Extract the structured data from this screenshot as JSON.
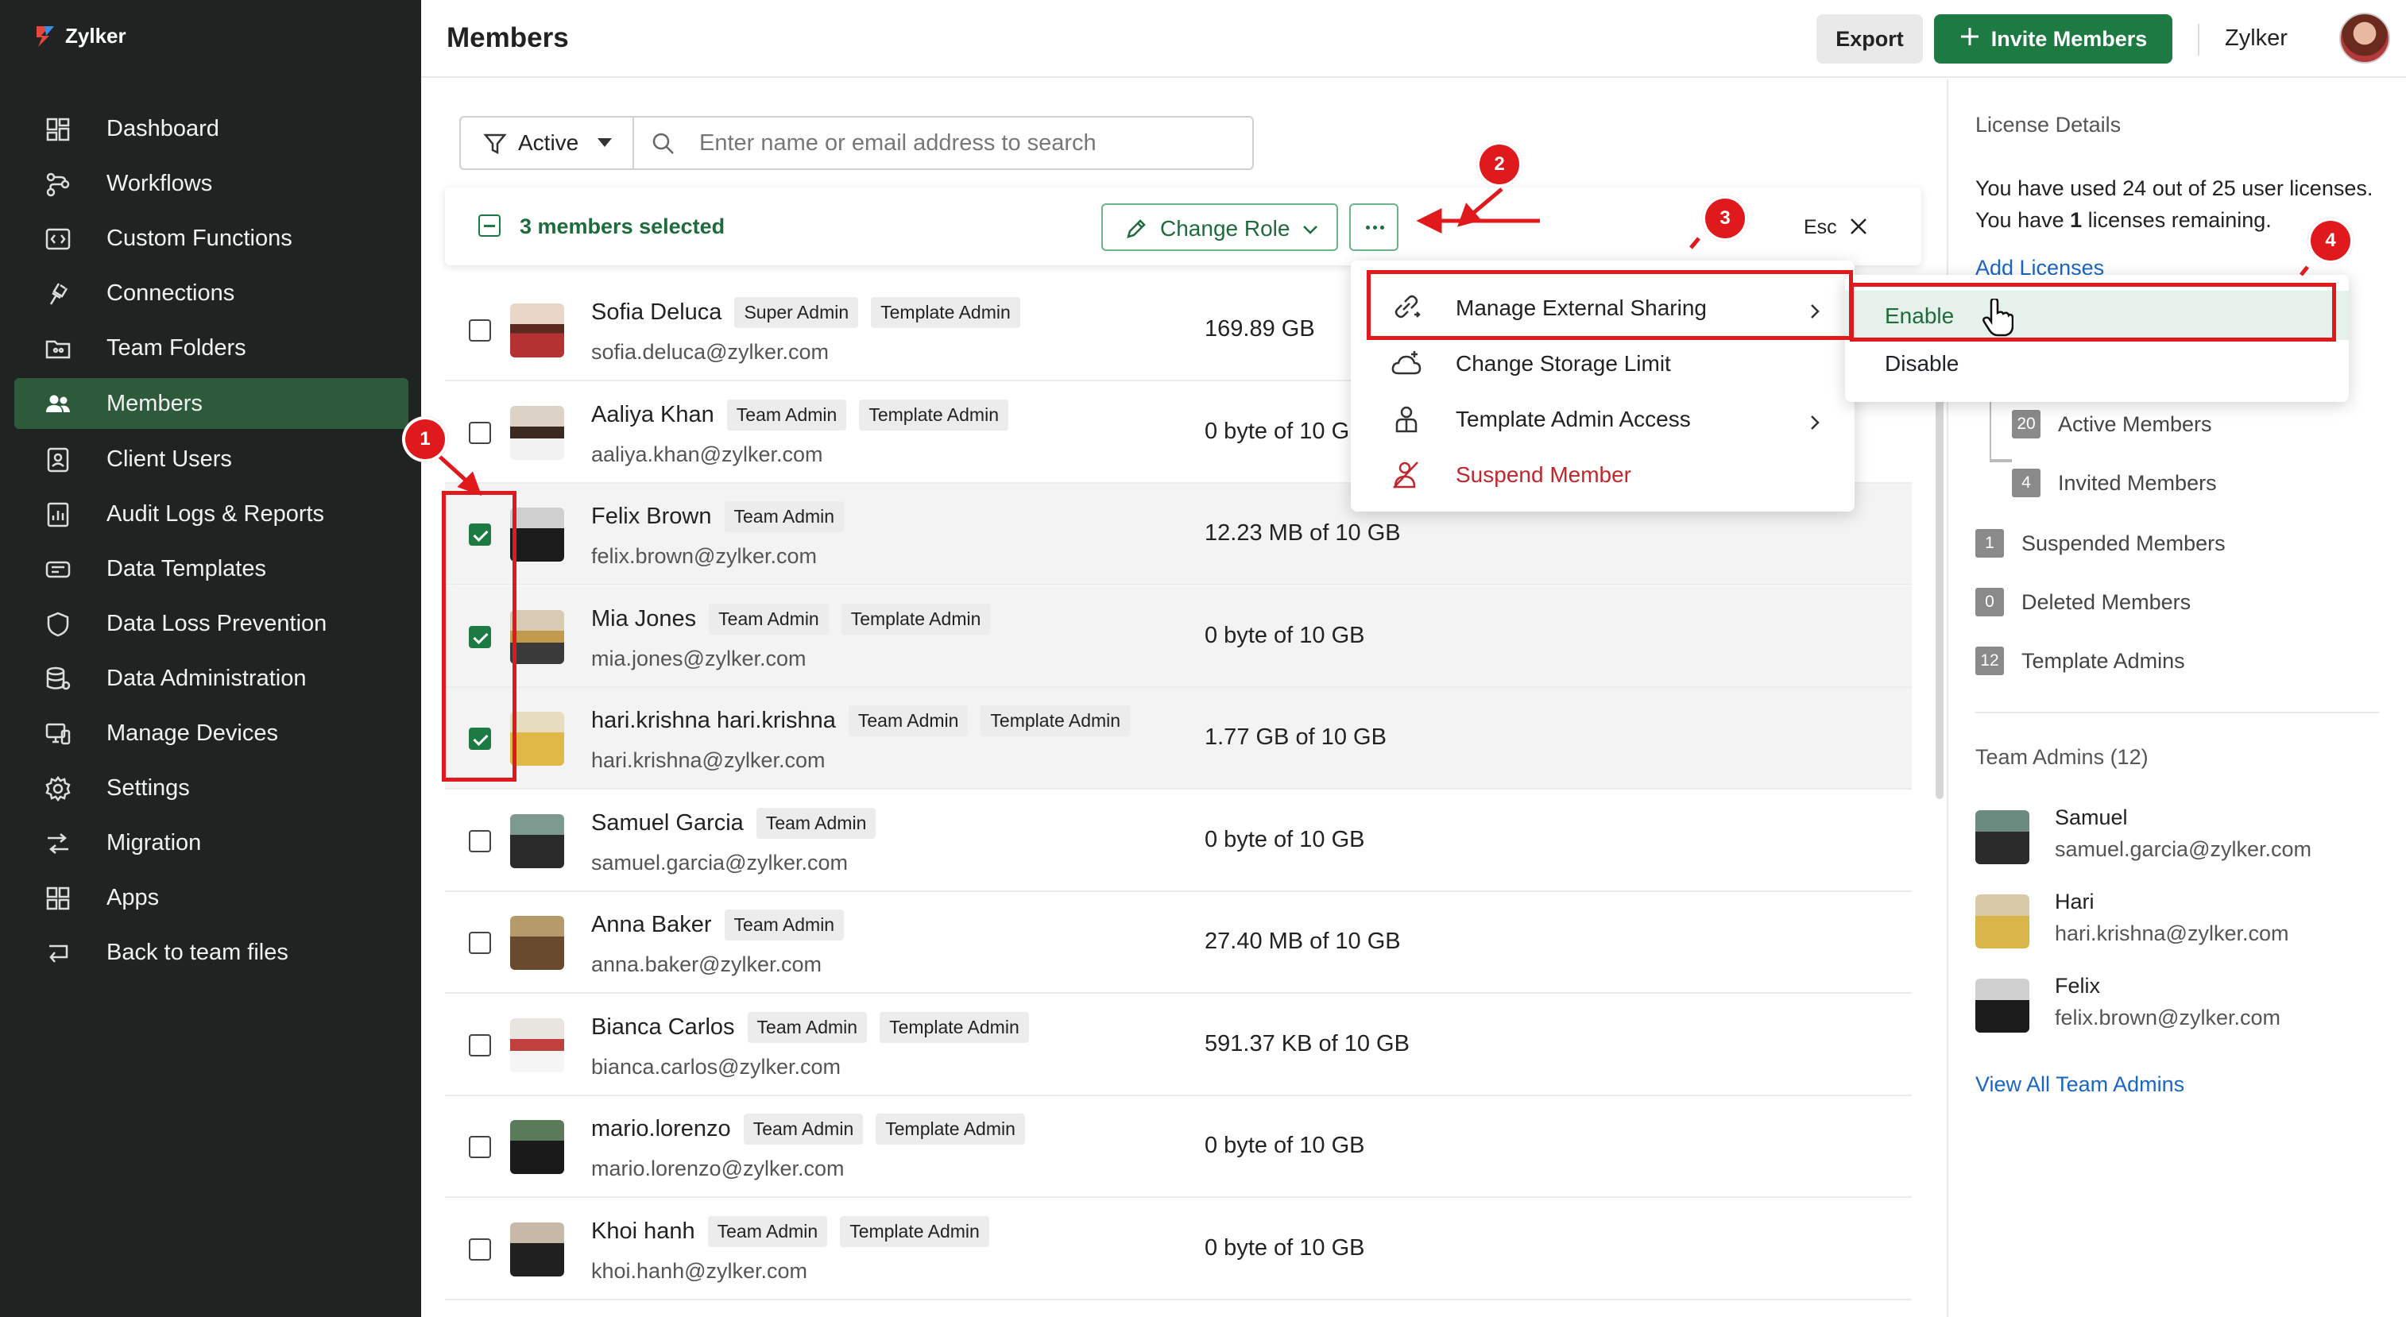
{
  "app": {
    "brand": "Zylker",
    "page_title": "Members"
  },
  "sidebar": {
    "items": [
      {
        "label": "Dashboard",
        "icon": "dashboard-icon"
      },
      {
        "label": "Workflows",
        "icon": "workflow-icon"
      },
      {
        "label": "Custom Functions",
        "icon": "code-icon"
      },
      {
        "label": "Connections",
        "icon": "plug-icon"
      },
      {
        "label": "Team Folders",
        "icon": "folder-icon"
      },
      {
        "label": "Members",
        "icon": "users-icon",
        "active": true
      },
      {
        "label": "Client Users",
        "icon": "contact-icon"
      },
      {
        "label": "Audit Logs & Reports",
        "icon": "report-icon"
      },
      {
        "label": "Data Templates",
        "icon": "template-icon"
      },
      {
        "label": "Data Loss Prevention",
        "icon": "shield-icon"
      },
      {
        "label": "Data Administration",
        "icon": "database-icon"
      },
      {
        "label": "Manage Devices",
        "icon": "devices-icon"
      },
      {
        "label": "Settings",
        "icon": "gear-icon"
      },
      {
        "label": "Migration",
        "icon": "migration-icon"
      },
      {
        "label": "Apps",
        "icon": "apps-icon"
      },
      {
        "label": "Back to team files",
        "icon": "back-icon"
      }
    ]
  },
  "header": {
    "export_label": "Export",
    "invite_label": "Invite Members",
    "org_name": "Zylker"
  },
  "filter": {
    "status": "Active",
    "search_placeholder": "Enter name or email address to search"
  },
  "selection": {
    "count_label": "3 members selected",
    "change_role_label": "Change Role",
    "esc_label": "Esc"
  },
  "members": [
    {
      "name": "Sofia Deluca",
      "badges": [
        "Super Admin",
        "Template Admin"
      ],
      "email": "sofia.deluca@zylker.com",
      "storage": "169.89 GB",
      "selected": false
    },
    {
      "name": "Aaliya Khan",
      "badges": [
        "Team Admin",
        "Template Admin"
      ],
      "email": "aaliya.khan@zylker.com",
      "storage": "0 byte of 10 G",
      "selected": false
    },
    {
      "name": "Felix Brown",
      "badges": [
        "Team Admin"
      ],
      "email": "felix.brown@zylker.com",
      "storage": "12.23 MB of 10 GB",
      "selected": true
    },
    {
      "name": "Mia Jones",
      "badges": [
        "Team Admin",
        "Template Admin"
      ],
      "email": "mia.jones@zylker.com",
      "storage": "0 byte of 10 GB",
      "selected": true
    },
    {
      "name": "hari.krishna hari.krishna",
      "badges": [
        "Team Admin",
        "Template Admin"
      ],
      "email": "hari.krishna@zylker.com",
      "storage": "1.77 GB of 10 GB",
      "selected": true
    },
    {
      "name": "Samuel Garcia",
      "badges": [
        "Team Admin"
      ],
      "email": "samuel.garcia@zylker.com",
      "storage": "0 byte of 10 GB",
      "selected": false
    },
    {
      "name": "Anna Baker",
      "badges": [
        "Team Admin"
      ],
      "email": "anna.baker@zylker.com",
      "storage": "27.40 MB of 10 GB",
      "selected": false
    },
    {
      "name": "Bianca Carlos",
      "badges": [
        "Team Admin",
        "Template Admin"
      ],
      "email": "bianca.carlos@zylker.com",
      "storage": "591.37 KB of 10 GB",
      "selected": false
    },
    {
      "name": "mario.lorenzo",
      "badges": [
        "Team Admin",
        "Template Admin"
      ],
      "email": "mario.lorenzo@zylker.com",
      "storage": "0 byte of 10 GB",
      "selected": false
    },
    {
      "name": "Khoi hanh",
      "badges": [
        "Team Admin",
        "Template Admin"
      ],
      "email": "khoi.hanh@zylker.com",
      "storage": "0 byte of 10 GB",
      "selected": false
    }
  ],
  "actions_menu": {
    "items": [
      {
        "label": "Manage External Sharing",
        "icon": "link-share-icon",
        "submenu": true
      },
      {
        "label": "Change Storage Limit",
        "icon": "cloud-icon",
        "submenu": false
      },
      {
        "label": "Template Admin Access",
        "icon": "user-admin-icon",
        "submenu": true
      },
      {
        "label": "Suspend Member",
        "icon": "suspend-user-icon",
        "submenu": false,
        "danger": true
      }
    ]
  },
  "sharing_submenu": {
    "enable_label": "Enable",
    "disable_label": "Disable"
  },
  "license_panel": {
    "heading": "License Details",
    "usage_text": "You have used 24 out of 25 user licenses.",
    "remaining_prefix": "You have ",
    "remaining_count": "1",
    "remaining_suffix": " licenses remaining.",
    "add_licenses_label": "Add Licenses",
    "counts": [
      {
        "count": "20",
        "label": "Active Members"
      },
      {
        "count": "4",
        "label": "Invited Members"
      },
      {
        "count": "1",
        "label": "Suspended Members"
      },
      {
        "count": "0",
        "label": "Deleted Members"
      },
      {
        "count": "12",
        "label": "Template Admins"
      }
    ],
    "team_admins_heading": "Team Admins (12)",
    "team_admins": [
      {
        "name": "Samuel",
        "email": "samuel.garcia@zylker.com"
      },
      {
        "name": "Hari",
        "email": "hari.krishna@zylker.com"
      },
      {
        "name": "Felix",
        "email": "felix.brown@zylker.com"
      }
    ],
    "view_all_label": "View All Team Admins"
  },
  "annotations": {
    "steps": [
      "1",
      "2",
      "3",
      "4"
    ],
    "color": "#e0191d"
  },
  "colors": {
    "sidebar_bg": "#1f2422",
    "sidebar_active": "#2c5a3a",
    "primary": "#1e7a43",
    "link": "#1a66c2",
    "danger": "#c0272d"
  }
}
